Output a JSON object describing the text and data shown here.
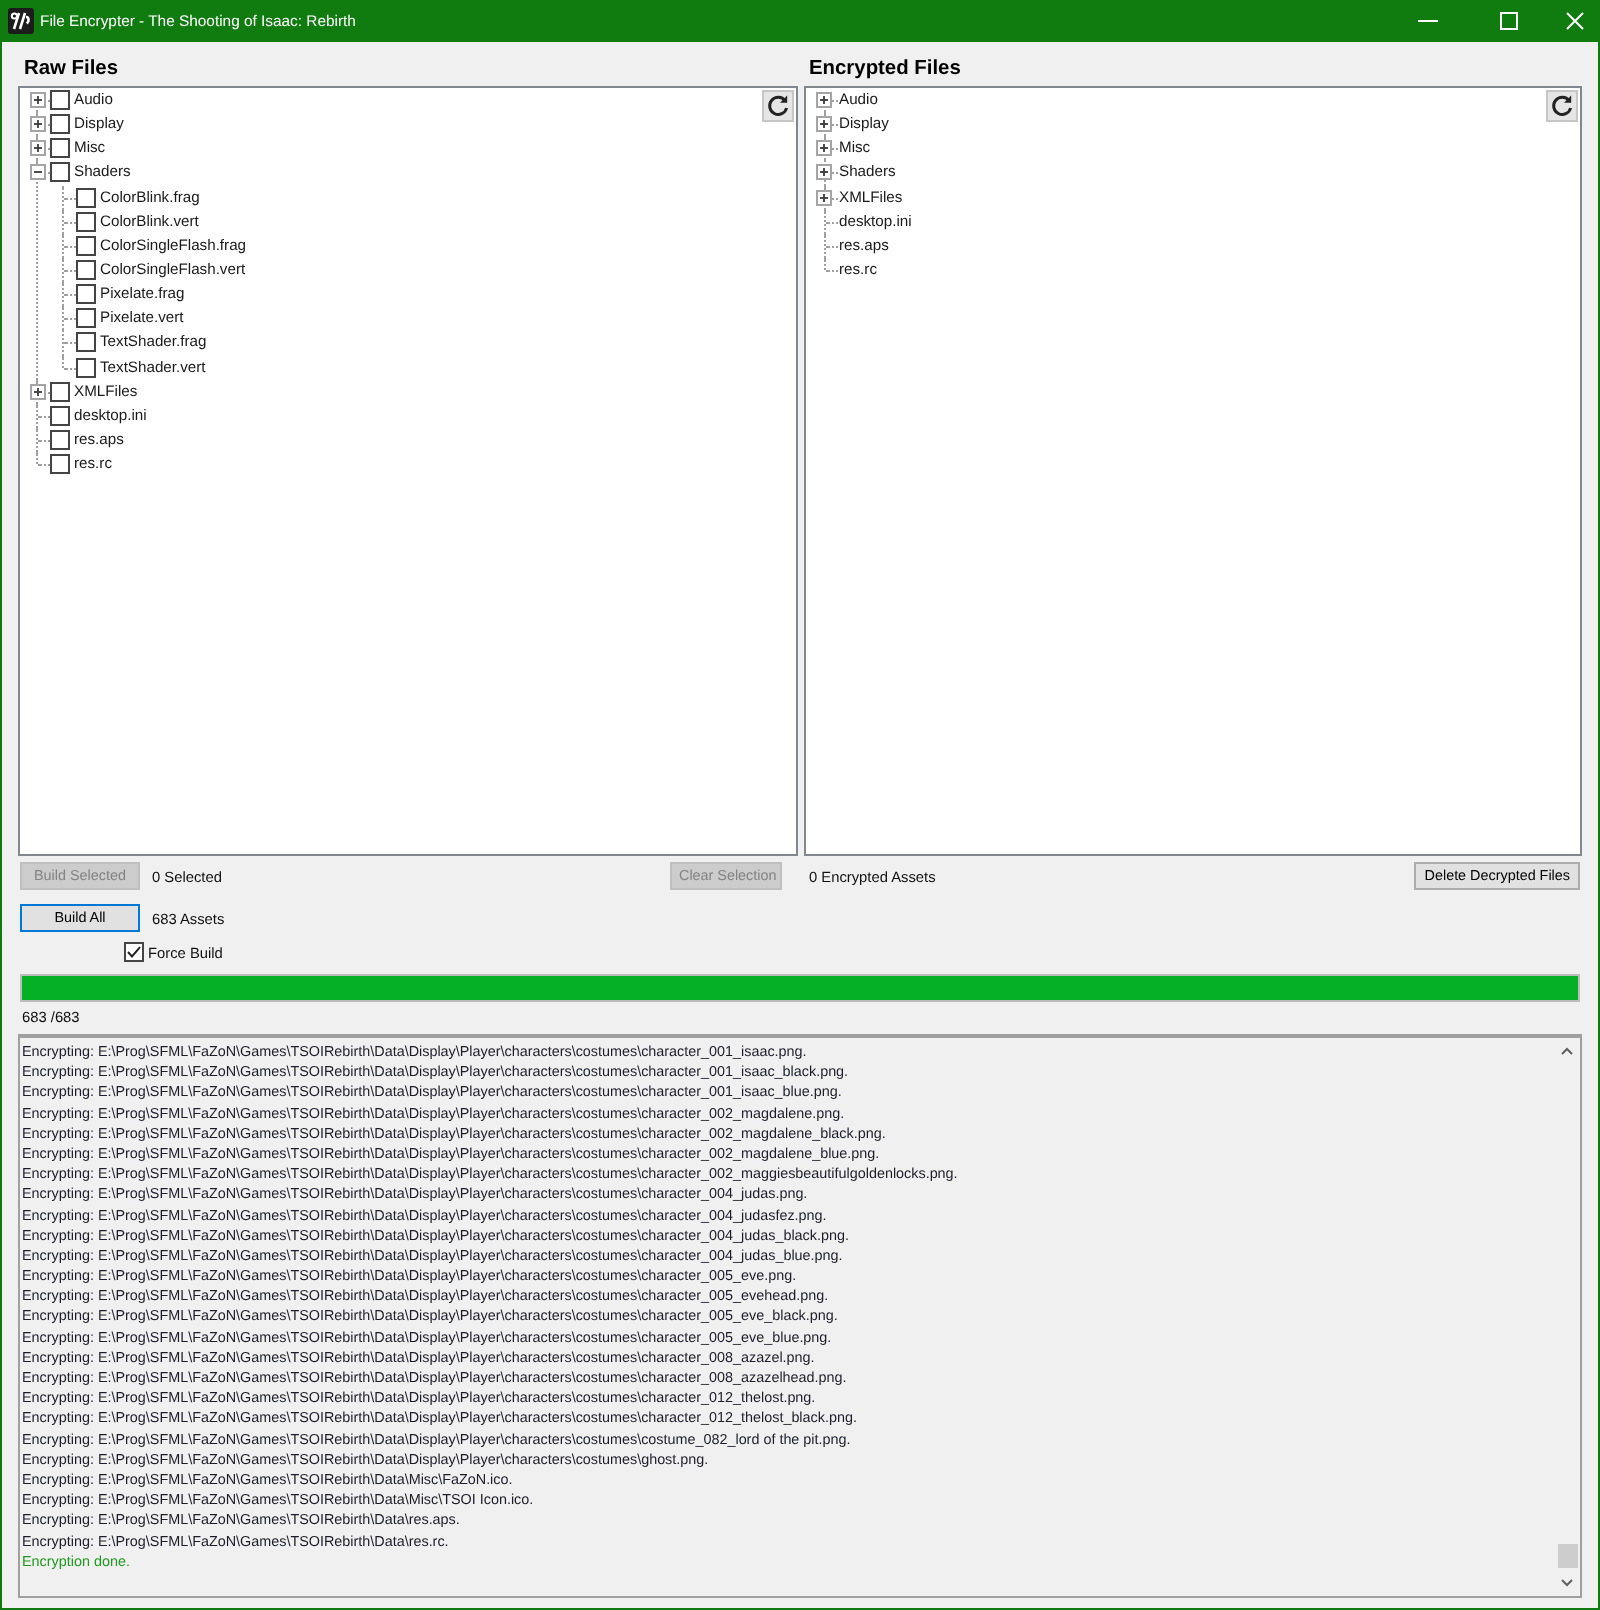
{
  "window": {
    "title": "File Encrypter - The Shooting of Isaac: Rebirth"
  },
  "raw_panel": {
    "title": "Raw Files",
    "tree": [
      {
        "kind": "folder",
        "label": "Audio",
        "expanded": false,
        "checked": false
      },
      {
        "kind": "folder",
        "label": "Display",
        "expanded": false,
        "checked": false
      },
      {
        "kind": "folder",
        "label": "Misc",
        "expanded": false,
        "checked": false
      },
      {
        "kind": "folder",
        "label": "Shaders",
        "expanded": true,
        "checked": false,
        "children": [
          {
            "kind": "file",
            "label": "ColorBlink.frag",
            "checked": false
          },
          {
            "kind": "file",
            "label": "ColorBlink.vert",
            "checked": false
          },
          {
            "kind": "file",
            "label": "ColorSingleFlash.frag",
            "checked": false
          },
          {
            "kind": "file",
            "label": "ColorSingleFlash.vert",
            "checked": false
          },
          {
            "kind": "file",
            "label": "Pixelate.frag",
            "checked": false
          },
          {
            "kind": "file",
            "label": "Pixelate.vert",
            "checked": false
          },
          {
            "kind": "file",
            "label": "TextShader.frag",
            "checked": false
          },
          {
            "kind": "file",
            "label": "TextShader.vert",
            "checked": false
          }
        ]
      },
      {
        "kind": "folder",
        "label": "XMLFiles",
        "expanded": false,
        "checked": false
      },
      {
        "kind": "file",
        "label": "desktop.ini",
        "checked": false
      },
      {
        "kind": "file",
        "label": "res.aps",
        "checked": false
      },
      {
        "kind": "file",
        "label": "res.rc",
        "checked": false
      }
    ],
    "build_selected_button": {
      "label": "Build Selected",
      "disabled": true,
      "focused": false
    },
    "selected_count": "0 Selected",
    "clear_selection_button": {
      "label": "Clear Selection",
      "disabled": true,
      "focused": false
    }
  },
  "encrypted_panel": {
    "title": "Encrypted Files",
    "tree": [
      {
        "kind": "folder",
        "label": "Audio",
        "expanded": false
      },
      {
        "kind": "folder",
        "label": "Display",
        "expanded": false
      },
      {
        "kind": "folder",
        "label": "Misc",
        "expanded": false
      },
      {
        "kind": "folder",
        "label": "Shaders",
        "expanded": false
      },
      {
        "kind": "folder",
        "label": "XMLFiles",
        "expanded": false
      },
      {
        "kind": "file",
        "label": "desktop.ini"
      },
      {
        "kind": "file",
        "label": "res.aps"
      },
      {
        "kind": "file",
        "label": "res.rc"
      }
    ],
    "asset_count": "0 Encrypted Assets",
    "delete_button": {
      "label": "Delete Decrypted Files",
      "disabled": false,
      "focused": false
    }
  },
  "build_all_button": {
    "label": "Build All",
    "disabled": false,
    "focused": true
  },
  "asset_total": "683 Assets",
  "force_build": {
    "label": "Force Build",
    "checked": true
  },
  "progress": {
    "level": 1,
    "reading": "683 /683"
  },
  "log": [
    {
      "kind": "entry",
      "text": "Encrypting: E:\\Prog\\SFML\\FaZoN\\Games\\TSOIRebirth\\Data\\Display\\Player\\characters\\costumes\\character_001_isaac.png."
    },
    {
      "kind": "entry",
      "text": "Encrypting: E:\\Prog\\SFML\\FaZoN\\Games\\TSOIRebirth\\Data\\Display\\Player\\characters\\costumes\\character_001_isaac_black.png."
    },
    {
      "kind": "entry",
      "text": "Encrypting: E:\\Prog\\SFML\\FaZoN\\Games\\TSOIRebirth\\Data\\Display\\Player\\characters\\costumes\\character_001_isaac_blue.png."
    },
    {
      "kind": "entry",
      "text": "Encrypting: E:\\Prog\\SFML\\FaZoN\\Games\\TSOIRebirth\\Data\\Display\\Player\\characters\\costumes\\character_002_magdalene.png."
    },
    {
      "kind": "entry",
      "text": "Encrypting: E:\\Prog\\SFML\\FaZoN\\Games\\TSOIRebirth\\Data\\Display\\Player\\characters\\costumes\\character_002_magdalene_black.png."
    },
    {
      "kind": "entry",
      "text": "Encrypting: E:\\Prog\\SFML\\FaZoN\\Games\\TSOIRebirth\\Data\\Display\\Player\\characters\\costumes\\character_002_magdalene_blue.png."
    },
    {
      "kind": "entry",
      "text": "Encrypting: E:\\Prog\\SFML\\FaZoN\\Games\\TSOIRebirth\\Data\\Display\\Player\\characters\\costumes\\character_002_maggiesbeautifulgoldenlocks.png."
    },
    {
      "kind": "entry",
      "text": "Encrypting: E:\\Prog\\SFML\\FaZoN\\Games\\TSOIRebirth\\Data\\Display\\Player\\characters\\costumes\\character_004_judas.png."
    },
    {
      "kind": "entry",
      "text": "Encrypting: E:\\Prog\\SFML\\FaZoN\\Games\\TSOIRebirth\\Data\\Display\\Player\\characters\\costumes\\character_004_judasfez.png."
    },
    {
      "kind": "entry",
      "text": "Encrypting: E:\\Prog\\SFML\\FaZoN\\Games\\TSOIRebirth\\Data\\Display\\Player\\characters\\costumes\\character_004_judas_black.png."
    },
    {
      "kind": "entry",
      "text": "Encrypting: E:\\Prog\\SFML\\FaZoN\\Games\\TSOIRebirth\\Data\\Display\\Player\\characters\\costumes\\character_004_judas_blue.png."
    },
    {
      "kind": "entry",
      "text": "Encrypting: E:\\Prog\\SFML\\FaZoN\\Games\\TSOIRebirth\\Data\\Display\\Player\\characters\\costumes\\character_005_eve.png."
    },
    {
      "kind": "entry",
      "text": "Encrypting: E:\\Prog\\SFML\\FaZoN\\Games\\TSOIRebirth\\Data\\Display\\Player\\characters\\costumes\\character_005_evehead.png."
    },
    {
      "kind": "entry",
      "text": "Encrypting: E:\\Prog\\SFML\\FaZoN\\Games\\TSOIRebirth\\Data\\Display\\Player\\characters\\costumes\\character_005_eve_black.png."
    },
    {
      "kind": "entry",
      "text": "Encrypting: E:\\Prog\\SFML\\FaZoN\\Games\\TSOIRebirth\\Data\\Display\\Player\\characters\\costumes\\character_005_eve_blue.png."
    },
    {
      "kind": "entry",
      "text": "Encrypting: E:\\Prog\\SFML\\FaZoN\\Games\\TSOIRebirth\\Data\\Display\\Player\\characters\\costumes\\character_008_azazel.png."
    },
    {
      "kind": "entry",
      "text": "Encrypting: E:\\Prog\\SFML\\FaZoN\\Games\\TSOIRebirth\\Data\\Display\\Player\\characters\\costumes\\character_008_azazelhead.png."
    },
    {
      "kind": "entry",
      "text": "Encrypting: E:\\Prog\\SFML\\FaZoN\\Games\\TSOIRebirth\\Data\\Display\\Player\\characters\\costumes\\character_012_thelost.png."
    },
    {
      "kind": "entry",
      "text": "Encrypting: E:\\Prog\\SFML\\FaZoN\\Games\\TSOIRebirth\\Data\\Display\\Player\\characters\\costumes\\character_012_thelost_black.png."
    },
    {
      "kind": "entry",
      "text": "Encrypting: E:\\Prog\\SFML\\FaZoN\\Games\\TSOIRebirth\\Data\\Display\\Player\\characters\\costumes\\costume_082_lord of the pit.png."
    },
    {
      "kind": "entry",
      "text": "Encrypting: E:\\Prog\\SFML\\FaZoN\\Games\\TSOIRebirth\\Data\\Display\\Player\\characters\\costumes\\ghost.png."
    },
    {
      "kind": "entry",
      "text": "Encrypting: E:\\Prog\\SFML\\FaZoN\\Games\\TSOIRebirth\\Data\\Misc\\FaZoN.ico."
    },
    {
      "kind": "entry",
      "text": "Encrypting: E:\\Prog\\SFML\\FaZoN\\Games\\TSOIRebirth\\Data\\Misc\\TSOI Icon.ico."
    },
    {
      "kind": "entry",
      "text": "Encrypting: E:\\Prog\\SFML\\FaZoN\\Games\\TSOIRebirth\\Data\\res.aps."
    },
    {
      "kind": "entry",
      "text": "Encrypting: E:\\Prog\\SFML\\FaZoN\\Games\\TSOIRebirth\\Data\\res.rc."
    },
    {
      "kind": "done",
      "text": "Encryption done."
    }
  ]
}
